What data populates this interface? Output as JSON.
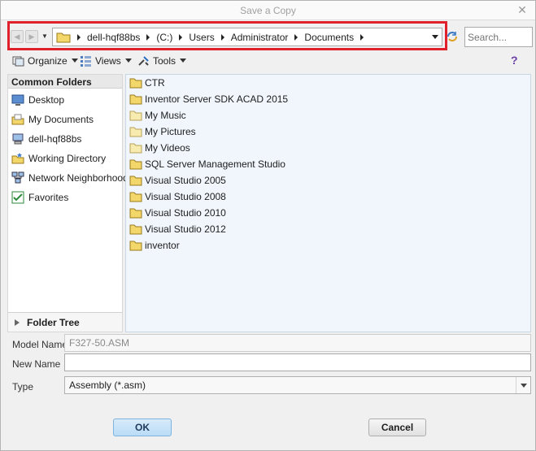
{
  "window": {
    "title": "Save a Copy",
    "close_glyph": "✕"
  },
  "navigation": {
    "back_icon": "arrow-left-icon",
    "forward_icon": "arrow-right-icon",
    "breadcrumbs": [
      "dell-hqf88bs",
      "(C:)",
      "Users",
      "Administrator",
      "Documents"
    ],
    "refresh_icon": "refresh-icon",
    "search_placeholder": "Search..."
  },
  "toolbar": {
    "organize_label": "Organize",
    "views_label": "Views",
    "tools_label": "Tools",
    "help_glyph": "?"
  },
  "sidebar": {
    "header": "Common Folders",
    "items": [
      {
        "label": "Desktop",
        "icon": "desktop-icon"
      },
      {
        "label": "My Documents",
        "icon": "documents-icon"
      },
      {
        "label": "dell-hqf88bs",
        "icon": "computer-icon"
      },
      {
        "label": "Working Directory",
        "icon": "working-directory-icon"
      },
      {
        "label": "Network Neighborhood",
        "icon": "network-icon"
      },
      {
        "label": "Favorites",
        "icon": "favorites-icon"
      }
    ],
    "folder_tree_label": "Folder Tree"
  },
  "files": [
    {
      "name": "CTR",
      "icon": "folder-icon"
    },
    {
      "name": "Inventor Server SDK ACAD 2015",
      "icon": "folder-icon"
    },
    {
      "name": "My Music",
      "icon": "folder-icon"
    },
    {
      "name": "My Pictures",
      "icon": "folder-icon"
    },
    {
      "name": "My Videos",
      "icon": "folder-icon"
    },
    {
      "name": "SQL Server Management Studio",
      "icon": "folder-icon"
    },
    {
      "name": "Visual Studio 2005",
      "icon": "folder-icon"
    },
    {
      "name": "Visual Studio 2008",
      "icon": "folder-icon"
    },
    {
      "name": "Visual Studio 2010",
      "icon": "folder-icon"
    },
    {
      "name": "Visual Studio 2012",
      "icon": "folder-icon"
    },
    {
      "name": "inventor",
      "icon": "folder-icon"
    }
  ],
  "form": {
    "model_name_label": "Model Name",
    "model_name_value": "F327-50.ASM",
    "new_name_label": "New Name",
    "new_name_value": "",
    "type_label": "Type",
    "type_value": "Assembly (*.asm)"
  },
  "buttons": {
    "ok_label": "OK",
    "cancel_label": "Cancel"
  },
  "colors": {
    "highlight": "#e0202a",
    "folder": "#f4d76a",
    "file_pane_bg": "#f0f6fc",
    "ok_button": "#c6e2f8"
  }
}
